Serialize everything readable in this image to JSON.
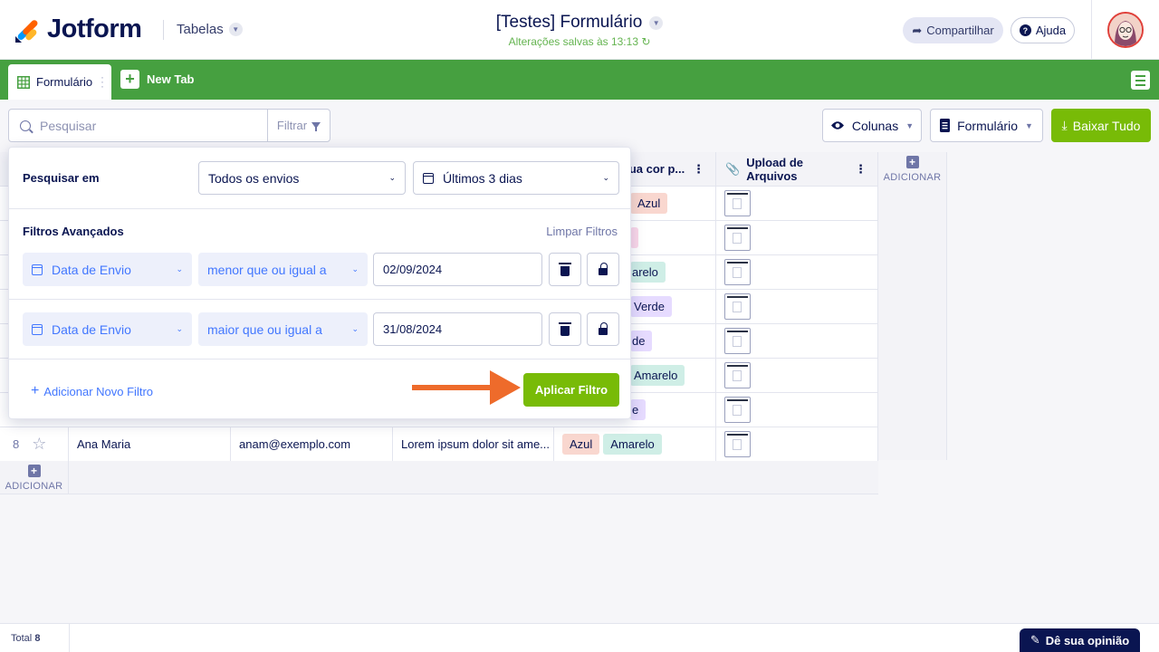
{
  "header": {
    "brand": "Jotform",
    "tables_label": "Tabelas",
    "form_title": "[Testes] Formulário",
    "saved_status": "Alterações salvas às 13:13",
    "share_label": "Compartilhar",
    "help_label": "Ajuda"
  },
  "tabs": {
    "active_tab": "Formulário",
    "new_tab": "New Tab"
  },
  "toolbar": {
    "search_placeholder": "Pesquisar",
    "filter_label": "Filtrar",
    "columns_label": "Colunas",
    "form_label": "Formulário",
    "download_label": "Baixar Tudo"
  },
  "table": {
    "columns": [
      {
        "label": "...ua cor p..."
      },
      {
        "label": "Upload de Arquivos"
      }
    ],
    "add_label": "ADICIONAR",
    "color_rows": [
      [
        "Azul"
      ],
      [
        ""
      ],
      [
        "arelo"
      ],
      [
        "Verde"
      ],
      [
        "de"
      ],
      [
        "Amarelo"
      ],
      [
        "e"
      ]
    ],
    "last_row": {
      "number": "8",
      "name": "Ana Maria",
      "email": "anam@exemplo.com",
      "text": "Lorem ipsum dolor sit ame...",
      "tags": [
        "Azul",
        "Amarelo"
      ]
    }
  },
  "filter_panel": {
    "search_in_label": "Pesquisar em",
    "search_in_value": "Todos os envios",
    "date_range_value": "Últimos 3 dias",
    "advanced_label": "Filtros Avançados",
    "clear_label": "Limpar Filtros",
    "filters": [
      {
        "field": "Data de Envio",
        "operator": "menor que ou igual a",
        "value": "02/09/2024"
      },
      {
        "field": "Data de Envio",
        "operator": "maior que ou igual a",
        "value": "31/08/2024"
      }
    ],
    "add_filter_label": "Adicionar Novo Filtro",
    "apply_label": "Aplicar Filtro"
  },
  "footer": {
    "total_label": "Total",
    "total_count": "8",
    "feedback_label": "Dê sua opinião"
  },
  "colors": {
    "green_bar": "#46a040",
    "apply_green": "#78bb07",
    "navy": "#0a1551",
    "arrow_orange": "#ee6b2b"
  }
}
